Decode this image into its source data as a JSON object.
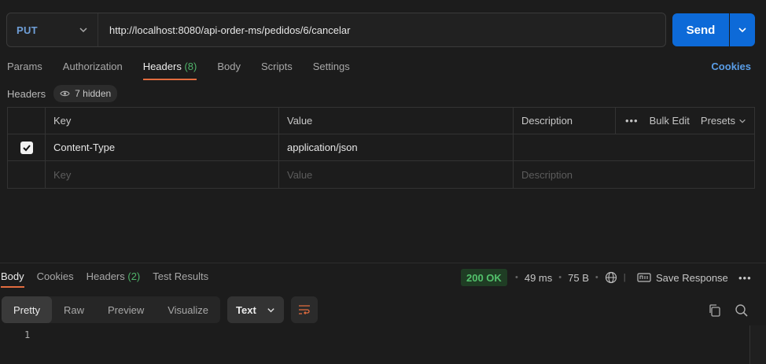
{
  "request": {
    "method": "PUT",
    "url": "http://localhost:8080/api-order-ms/pedidos/6/cancelar",
    "send_label": "Send"
  },
  "request_tabs": [
    {
      "label": "Params"
    },
    {
      "label": "Authorization"
    },
    {
      "label": "Headers",
      "count": "(8)"
    },
    {
      "label": "Body"
    },
    {
      "label": "Scripts"
    },
    {
      "label": "Settings"
    }
  ],
  "cookies_label": "Cookies",
  "headers_section": {
    "label": "Headers",
    "hidden_label": "7 hidden"
  },
  "headers_table": {
    "columns": {
      "key": "Key",
      "value": "Value",
      "description": "Description"
    },
    "bulk_edit": "Bulk Edit",
    "presets": "Presets",
    "rows": [
      {
        "key": "Content-Type",
        "value": "application/json",
        "description": "",
        "checked": true
      }
    ],
    "placeholders": {
      "key": "Key",
      "value": "Value",
      "description": "Description"
    }
  },
  "response_tabs": [
    {
      "label": "Body"
    },
    {
      "label": "Cookies"
    },
    {
      "label": "Headers",
      "count": "(2)"
    },
    {
      "label": "Test Results"
    }
  ],
  "response_meta": {
    "status": "200 OK",
    "time": "49 ms",
    "size": "75 B",
    "save_label": "Save Response"
  },
  "body_view": {
    "modes": [
      "Pretty",
      "Raw",
      "Preview",
      "Visualize"
    ],
    "active_mode": "Pretty",
    "format": "Text",
    "line_numbers": [
      "1"
    ]
  },
  "colors": {
    "accent": "#e26c3f",
    "send": "#0d6ad8",
    "method": "#6f9fd8",
    "status_ok": "#53c26c"
  }
}
